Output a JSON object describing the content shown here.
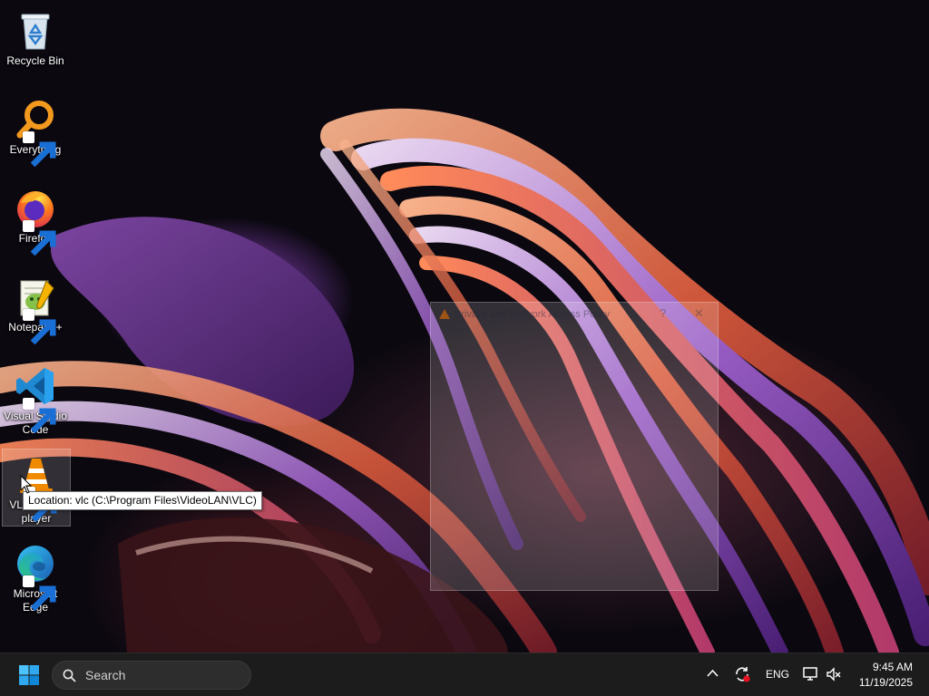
{
  "desktop": {
    "icons": [
      {
        "label": "Recycle Bin",
        "icon": "recycle-bin-icon"
      },
      {
        "label": "Everything",
        "icon": "everything-search-icon"
      },
      {
        "label": "Firefox",
        "icon": "firefox-icon"
      },
      {
        "label": "Notepad++",
        "icon": "notepad-plus-plus-icon"
      },
      {
        "label": "Visual Studio Code",
        "icon": "vscode-icon"
      },
      {
        "label": "VLC media player",
        "icon": "vlc-icon"
      },
      {
        "label": "Microsoft Edge",
        "icon": "edge-icon"
      }
    ],
    "tooltip": "Location: vlc (C:\\Program Files\\VideoLAN\\VLC)"
  },
  "ghost_window": {
    "title": "Privacy and Network Access Policy"
  },
  "taskbar": {
    "search_placeholder": "Search",
    "language": "ENG",
    "time": "9:45 AM",
    "date": "11/19/2025"
  },
  "colors": {
    "taskbar_bg": "#1c1c1c",
    "windows_blue": "#0078d4",
    "vlc_orange": "#f08a00"
  }
}
